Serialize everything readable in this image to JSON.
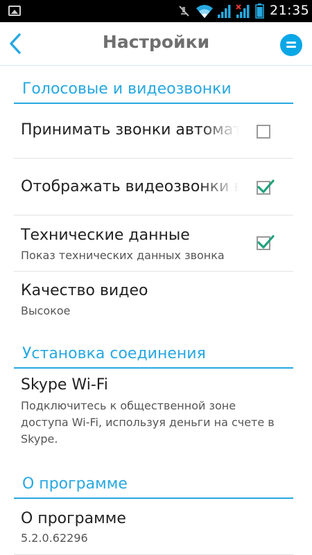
{
  "status_bar": {
    "time": "21:35",
    "icons": [
      "image-icon",
      "mute-icon",
      "wifi-icon",
      "signal-icon",
      "signal-no-data-icon",
      "battery-icon"
    ]
  },
  "header": {
    "title": "Настройки",
    "back_icon": "chevron-left-icon",
    "menu_icon": "menu-icon"
  },
  "colors": {
    "accent": "#27a8e0",
    "menu_button": "#0aa7e6",
    "checkmark": "#1fa37d",
    "title_text": "#6f6f6f"
  },
  "sections": {
    "calls": {
      "title": "Голосовые и видеозвонки",
      "items": [
        {
          "title": "Принимать звонки автомат",
          "checked": false
        },
        {
          "title": "Отображать видеозвонки в",
          "checked": true
        },
        {
          "title": "Технические данные",
          "subtitle": "Показ технических данных звонка",
          "checked": true
        },
        {
          "title": "Качество видео",
          "subtitle": "Высокое"
        }
      ]
    },
    "connection": {
      "title": "Установка соединения",
      "items": [
        {
          "title": "Skype Wi-Fi",
          "subtitle": "Подключитесь к общественной зоне доступа Wi-Fi, используя деньги на счете в Skype."
        }
      ]
    },
    "about": {
      "title": "О программе",
      "items": [
        {
          "title": "О программе",
          "subtitle": "5.2.0.62296"
        }
      ]
    }
  }
}
